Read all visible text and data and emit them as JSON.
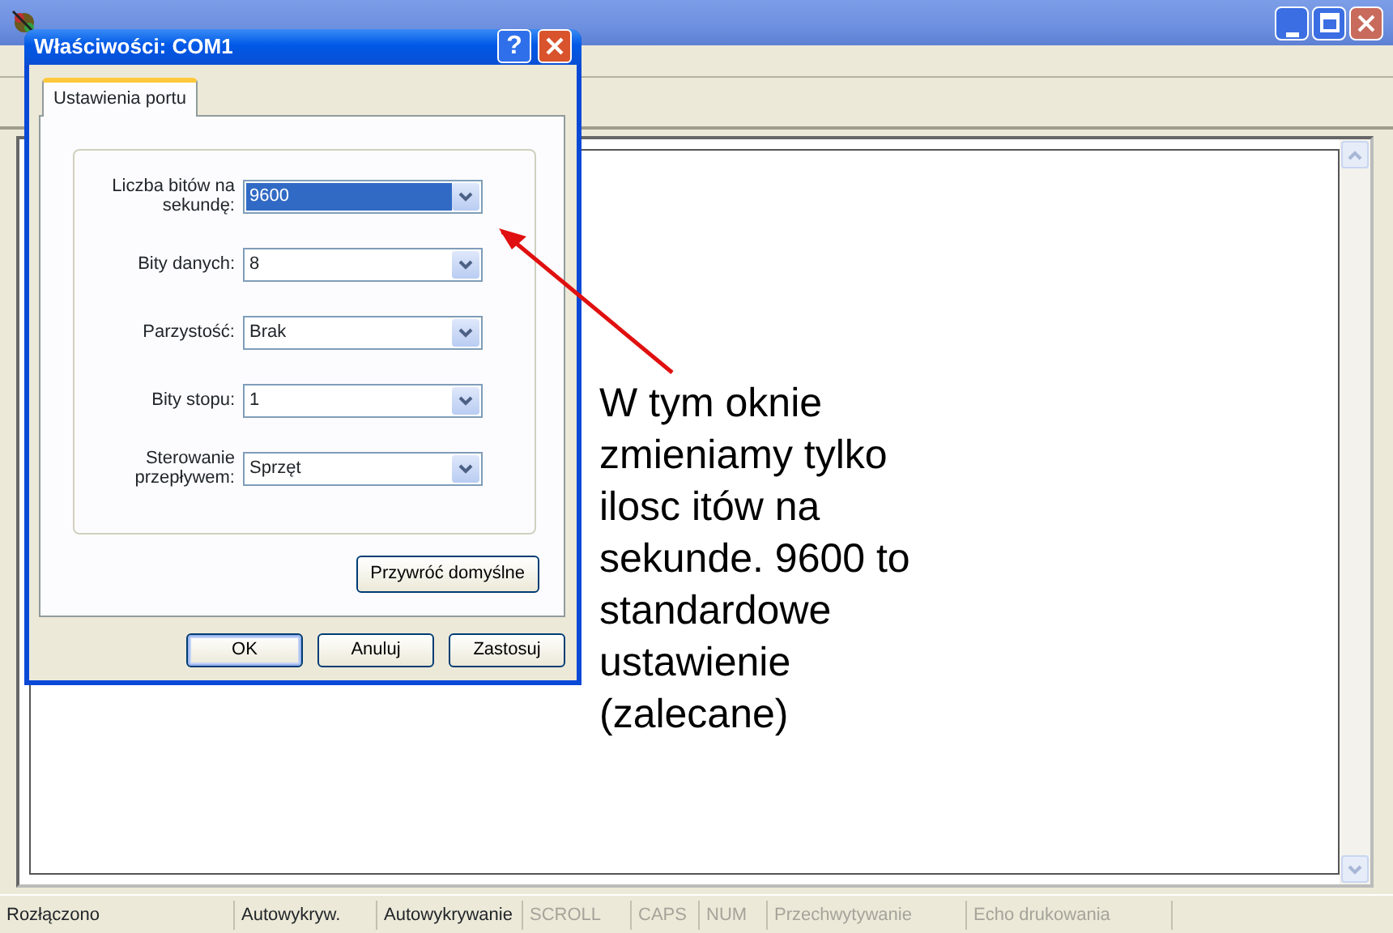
{
  "dialog": {
    "title": "Właściwości: COM1",
    "help_button": "?",
    "tabs": [
      {
        "label": "Ustawienia portu",
        "selected": true
      }
    ],
    "fields": [
      {
        "label": "Liczba bitów na sekundę:",
        "value": "9600",
        "focused": true
      },
      {
        "label": "Bity danych:",
        "value": "8",
        "focused": false
      },
      {
        "label": "Parzystość:",
        "value": "Brak",
        "focused": false
      },
      {
        "label": "Bity stopu:",
        "value": "1",
        "focused": false
      },
      {
        "label": "Sterowanie przepływem:",
        "value": "Sprzęt",
        "focused": false
      }
    ],
    "restore_button": "Przywróć domyślne",
    "buttons": [
      {
        "label": "OK",
        "default": true
      },
      {
        "label": "Anuluj",
        "default": false
      },
      {
        "label": "Zastosuj",
        "default": false
      }
    ]
  },
  "annotation": {
    "lines": [
      "W tym oknie",
      "zmieniamy tylko",
      "ilosc itów na",
      "sekunde. 9600 to",
      "standardowe",
      "ustawienie",
      "(zalecane)"
    ]
  },
  "status_bar": [
    {
      "text": "Rozłączono",
      "disabled": false
    },
    {
      "text": "Autowykryw.",
      "disabled": false
    },
    {
      "text": "Autowykrywanie",
      "disabled": false
    },
    {
      "text": "SCROLL",
      "disabled": true
    },
    {
      "text": "CAPS",
      "disabled": true
    },
    {
      "text": "NUM",
      "disabled": true
    },
    {
      "text": "Przechwytywanie",
      "disabled": true
    },
    {
      "text": "Echo drukowania",
      "disabled": true
    }
  ]
}
